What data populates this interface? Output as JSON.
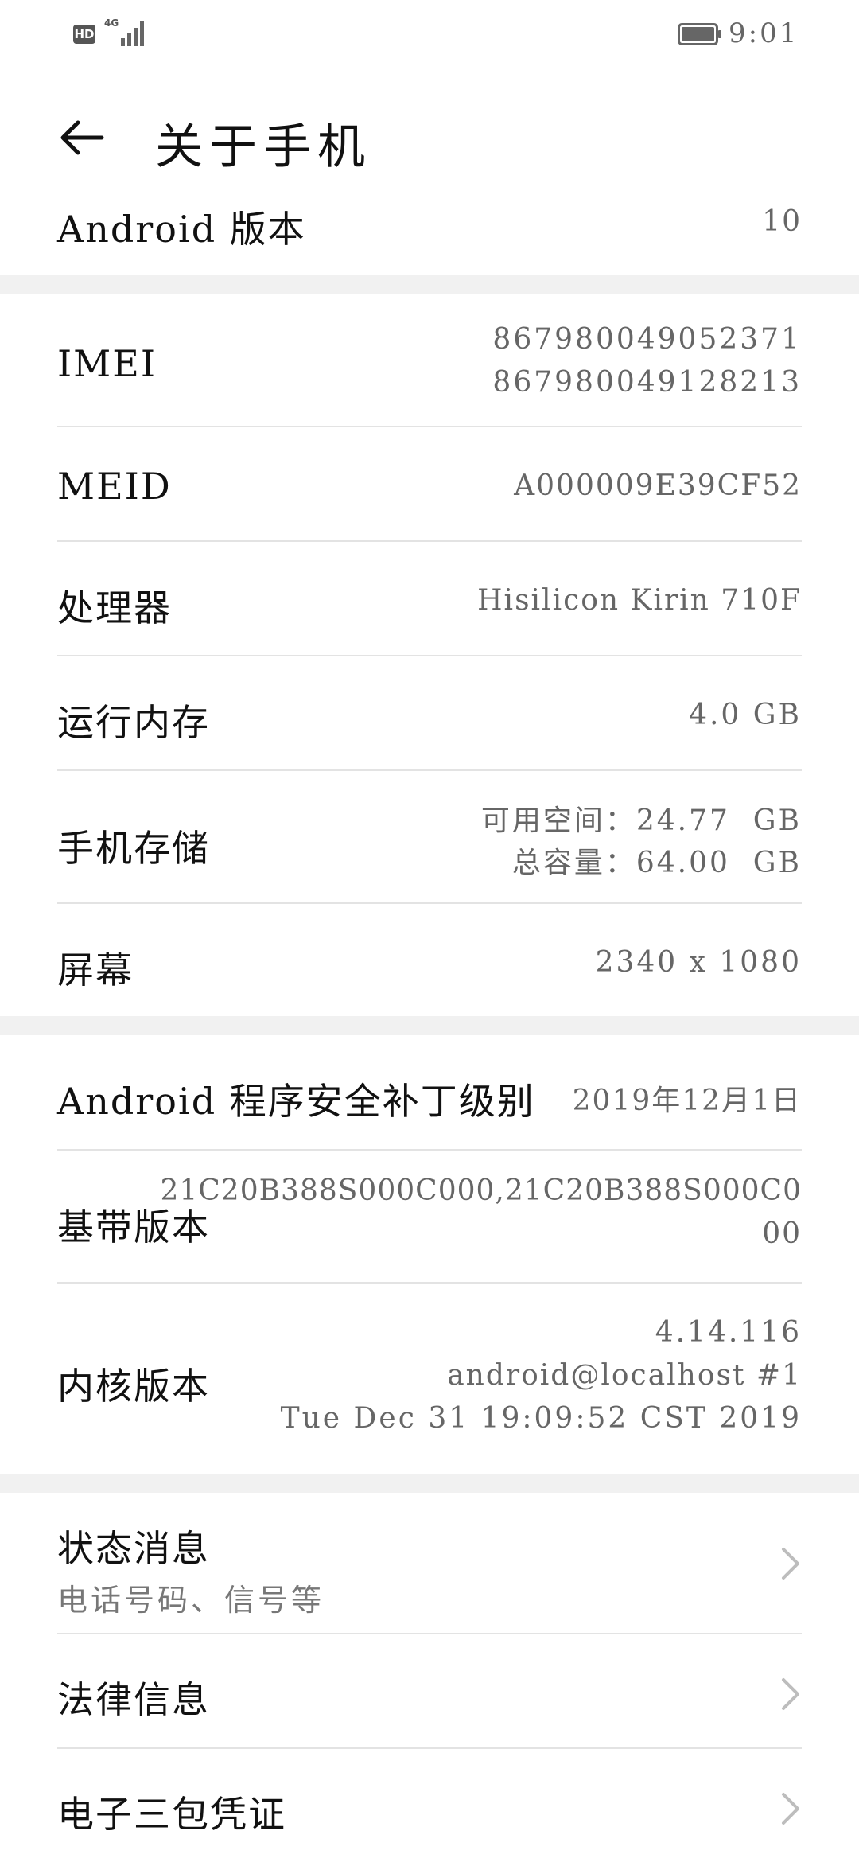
{
  "status_bar": {
    "hd_label": "HD",
    "network_label": "4G",
    "time": "9:01",
    "icons": [
      "hd-icon",
      "signal-icon",
      "battery-icon"
    ]
  },
  "header": {
    "title": "关于手机",
    "back_icon": "arrow-left-icon"
  },
  "android_version": {
    "label": "Android 版本",
    "value": "10"
  },
  "imei": {
    "label": "IMEI",
    "value_1": "867980049052371",
    "value_2": "867980049128213"
  },
  "meid": {
    "label": "MEID",
    "value": "A000009E39CF52"
  },
  "processor": {
    "label": "处理器",
    "value": "Hisilicon Kirin 710F"
  },
  "ram": {
    "label": "运行内存",
    "value": "4.0 GB"
  },
  "storage": {
    "label": "手机存储",
    "available": "可用空间：24.77  GB",
    "total": "总容量：64.00  GB"
  },
  "screen": {
    "label": "屏幕",
    "value": "2340 x 1080"
  },
  "security_patch": {
    "label": "Android 程序安全补丁级别",
    "value": "2019年12月1日"
  },
  "baseband": {
    "label": "基带版本",
    "value_1": "21C20B388S000C000,21C20B388S000C0",
    "value_2": "00"
  },
  "kernel": {
    "label": "内核版本",
    "value_1": "4.14.116",
    "value_2": "android@localhost #1",
    "value_3": "Tue Dec 31 19:09:52 CST 2019"
  },
  "links": {
    "status": {
      "label": "状态消息",
      "sublabel": "电话号码、信号等"
    },
    "legal": {
      "label": "法律信息"
    },
    "warranty": {
      "label": "电子三包凭证"
    },
    "chevron_icon": "chevron-right-icon"
  },
  "colors": {
    "background": "#ffffff",
    "section_gap": "#f1f1f1",
    "divider": "#e3e3e3",
    "primary_text": "#111111",
    "secondary_text": "#666666"
  }
}
